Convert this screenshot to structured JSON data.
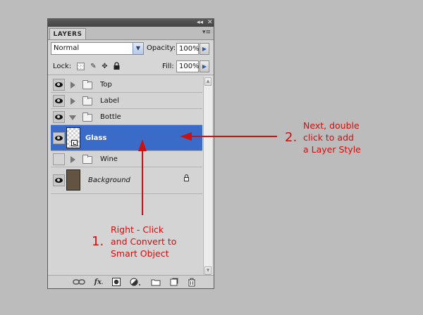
{
  "panel": {
    "tab_label": "LAYERS",
    "collapse_glyph": "◂◂",
    "close_glyph": "✕",
    "menu_glyph": "▾≡"
  },
  "blend_row": {
    "mode": "Normal",
    "opacity_label": "Opacity:",
    "opacity_value": "100%"
  },
  "lock_row": {
    "lock_label": "Lock:",
    "lock_icons": [
      "lock-transparent-pixels-icon",
      "lock-image-pixels-icon",
      "lock-position-icon",
      "lock-all-icon"
    ],
    "fill_label": "Fill:",
    "fill_value": "100%"
  },
  "layers": [
    {
      "name": "Top",
      "type": "group",
      "expanded": false,
      "visible": true
    },
    {
      "name": "Label",
      "type": "group",
      "expanded": false,
      "visible": true
    },
    {
      "name": "Bottle",
      "type": "group",
      "expanded": true,
      "visible": true
    },
    {
      "name": "Glass",
      "type": "smart-object",
      "selected": true,
      "visible": true
    },
    {
      "name": "Wine",
      "type": "group",
      "expanded": false,
      "visible": false
    },
    {
      "name": "Background",
      "type": "pixel",
      "locked": true,
      "visible": true
    }
  ],
  "toolbar_icons": [
    "link-layers-icon",
    "fx-icon",
    "add-mask-icon",
    "adjustment-layer-icon",
    "new-group-icon",
    "new-layer-icon",
    "delete-layer-icon"
  ],
  "toolbar": {
    "fx_label": "fx"
  },
  "annotations": {
    "step2_number": "2.",
    "step2_lines": [
      "Next, double",
      "click to add",
      "a Layer Style"
    ],
    "step1_number": "1.",
    "step1_lines": [
      "Right - Click",
      "and Convert to",
      "Smart Object"
    ]
  },
  "colors": {
    "background": "#bcbcbc",
    "panel": "#d6d6d6",
    "selection": "#3b6bc9",
    "annotation": "#cc1111",
    "background_layer_fill": "#625440"
  }
}
